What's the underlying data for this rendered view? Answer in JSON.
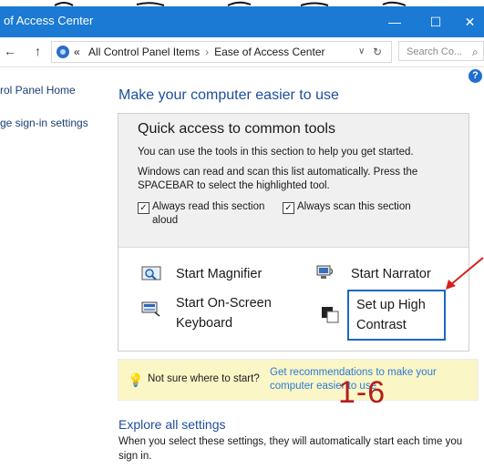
{
  "window": {
    "title": "of Access Center",
    "minimize_glyph": "—",
    "maximize_glyph": "☐",
    "close_glyph": "✕"
  },
  "navigation": {
    "back_glyph": "←",
    "up_glyph": "↑",
    "overflow": "«",
    "separator": "›",
    "breadcrumb": [
      "All Control Panel Items",
      "Ease of Access Center"
    ],
    "dropdown_glyph": "∨",
    "refresh_glyph": "↻",
    "search_placeholder": "Search Co...",
    "search_icon": "search-icon"
  },
  "help": {
    "label": "?"
  },
  "sidebar": {
    "items": [
      {
        "label": "rol Panel Home"
      },
      {
        "label": "ge sign-in settings"
      }
    ]
  },
  "main": {
    "heading": "Make your computer easier to use",
    "quick_access": {
      "title": "Quick access to common tools",
      "intro": "You can use the tools in this section to help you get started.",
      "scan_text": "Windows can read and scan this list automatically.  Press the SPACEBAR to select the highlighted tool.",
      "checkboxes": [
        {
          "label_line1": "Always read this section",
          "label_line2": "aloud",
          "checked": true,
          "glyph": "✓"
        },
        {
          "label_line1": "Always scan this section",
          "checked": true,
          "glyph": "✓"
        }
      ],
      "tools": [
        {
          "label": "Start Magnifier",
          "icon": "magnifier-icon"
        },
        {
          "label": "Start Narrator",
          "icon": "narrator-icon"
        },
        {
          "label_line1": "Start On-Screen",
          "label_line2": "Keyboard",
          "icon": "keyboard-icon"
        },
        {
          "label_line1": "Set up High",
          "label_line2": "Contrast",
          "icon": "high-contrast-icon"
        }
      ]
    },
    "tip": {
      "question": "Not sure where to start?",
      "link": "Get recommendations to make your computer easier to use"
    },
    "annotation": "1-6",
    "explore": {
      "title": "Explore all settings",
      "description": "When you select these settings, they will automatically start each time you sign in."
    }
  },
  "colors": {
    "titlebar": "#1b7ad3",
    "link": "#2a7bd8",
    "heading": "#1e4e9c",
    "tip_background": "#fbf6c5",
    "annotation_red": "#b31e1e",
    "focus_border": "#1b66c9"
  }
}
